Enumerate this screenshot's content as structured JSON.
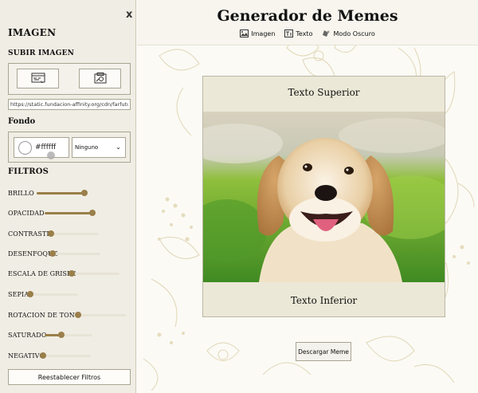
{
  "header": {
    "title": "Generador de Memes",
    "nav": [
      {
        "label": "Imagen",
        "icon": "image-icon"
      },
      {
        "label": "Texto",
        "icon": "text-icon"
      },
      {
        "label": "Modo Oscuro",
        "icon": "dark-mode-icon"
      }
    ]
  },
  "sidebar": {
    "close_label": "x",
    "section_title": "IMAGEN",
    "upload_title": "SUBIR IMAGEN",
    "url_value": "https://static.fundacion-affinity.org/cdn/farfuture/P",
    "fondo_title": "Fondo",
    "color_value": "#ffffff",
    "blend_selected": "Ninguno",
    "filters_title": "FILTROS",
    "filters": [
      {
        "label": "BRILLO",
        "value": 1
      },
      {
        "label": "OPACIDAD",
        "value": 1
      },
      {
        "label": "CONTRASTE",
        "value": 0
      },
      {
        "label": "DESENFOQUE",
        "value": 0
      },
      {
        "label": "ESCALA DE GRISES",
        "value": 0
      },
      {
        "label": "SEPIA",
        "value": 0
      },
      {
        "label": "ROTACION DE TONO",
        "value": 0
      },
      {
        "label": "SATURADO",
        "value": 0.35
      },
      {
        "label": "NEGATIVO",
        "value": 0
      }
    ],
    "reset_label": "Reestablecer Filtros"
  },
  "meme": {
    "top_text": "Texto Superior",
    "bottom_text": "Texto Inferior"
  },
  "download_label": "Descargar Meme",
  "colors": {
    "accent": "#9a7f4a",
    "panel": "#efece2",
    "meme_bg": "#ece8d7"
  }
}
